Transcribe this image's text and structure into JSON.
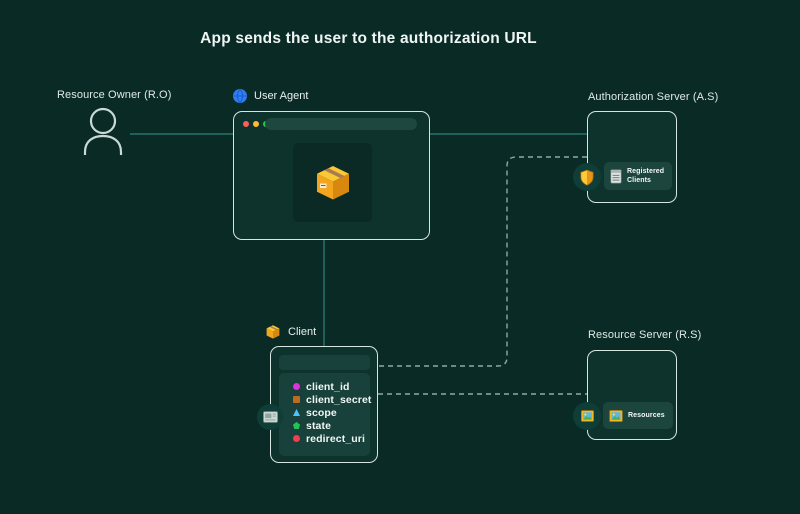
{
  "title": "App sends the user to the authorization URL",
  "resource_owner": {
    "label": "Resource Owner (R.O)",
    "icon": "person-icon"
  },
  "user_agent": {
    "label": "User Agent",
    "icon": "globe-icon",
    "browser": {
      "address_bar_value": "",
      "content_icon": "package-icon"
    }
  },
  "client": {
    "label": "Client",
    "icon": "package-icon",
    "side_icon": "card-terminal-icon",
    "params": [
      {
        "name": "client_id",
        "color": "#d935d9",
        "shape": "circle"
      },
      {
        "name": "client_secret",
        "color": "#bf6a1e",
        "shape": "square"
      },
      {
        "name": "scope",
        "color": "#4fc3f7",
        "shape": "triangle"
      },
      {
        "name": "state",
        "color": "#23c552",
        "shape": "pentagon"
      },
      {
        "name": "redirect_uri",
        "color": "#ee4050",
        "shape": "circle"
      }
    ]
  },
  "authorization_server": {
    "label": "Authorization Server (A.S)",
    "badge_label": "Registered Clients",
    "badge_icon": "ledger-icon",
    "side_icon": "shield-icon"
  },
  "resource_server": {
    "label": "Resource Server (R.S)",
    "badge_label": "Resources",
    "badge_icon": "framed-picture-icon",
    "side_icon": "framed-picture-icon"
  },
  "colors": {
    "background": "#0a2a25",
    "panel": "#0e322c",
    "panel_inner": "#17413a",
    "panel_border": "#d8e6e2",
    "solid_line": "#206058",
    "dashed_line": "#8fa9a3",
    "traffic_lights": [
      "#ff5f57",
      "#febc2e",
      "#2ecc40"
    ],
    "shield": "#f2a21c",
    "package": "#f2a51d",
    "globe": "#2f7df0"
  }
}
